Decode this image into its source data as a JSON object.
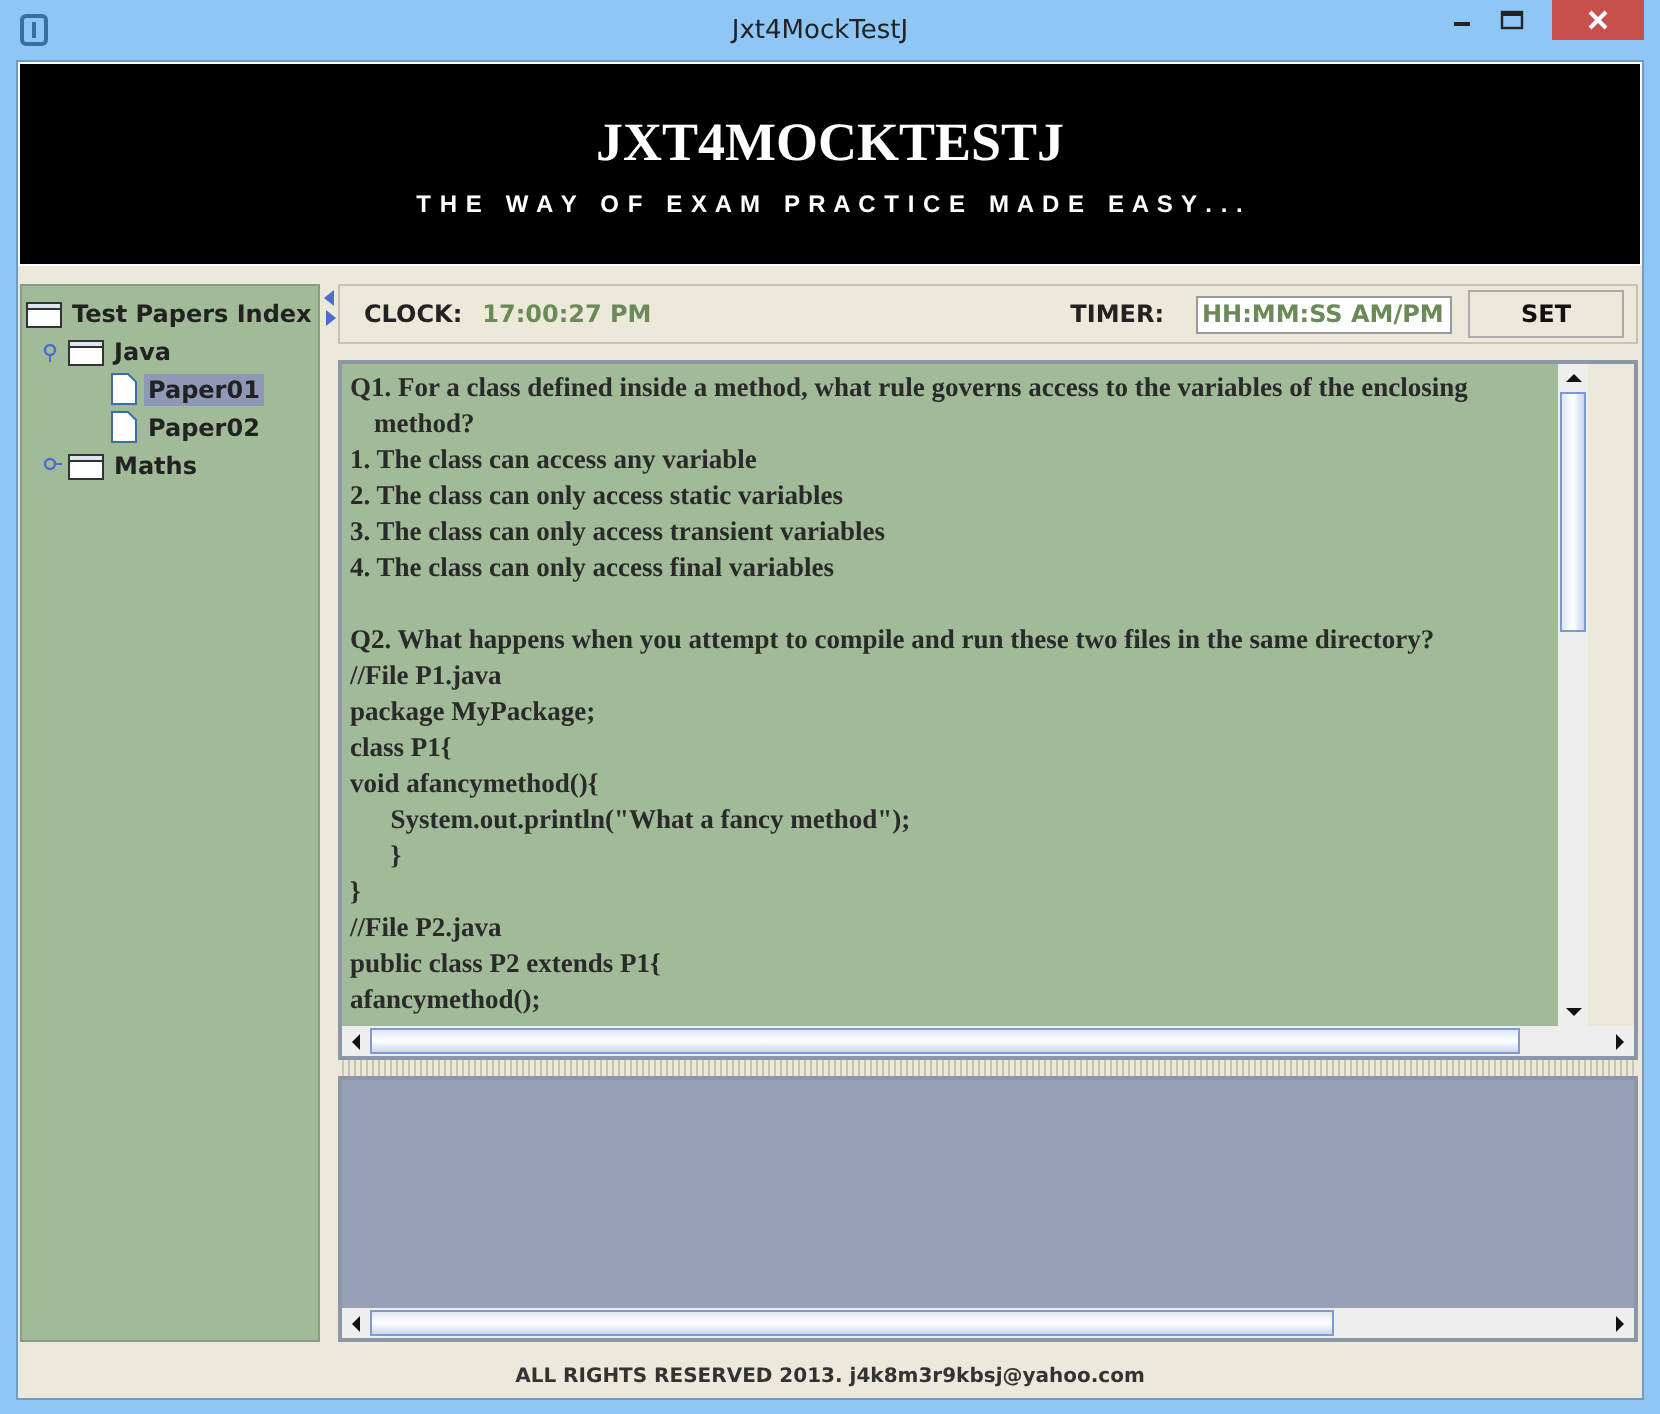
{
  "window": {
    "title": "Jxt4MockTestJ"
  },
  "banner": {
    "title": "JXT4MOCKTESTJ",
    "tagline": "T H E   W A Y   O F   E X A M   P R A C T I C E   M A D E   E A S Y . . ."
  },
  "tree": {
    "root": "Test Papers Index",
    "items": [
      {
        "label": "Java",
        "kind": "folder",
        "expanded": true,
        "selected": false,
        "children": [
          {
            "label": "Paper01",
            "kind": "file",
            "selected": true
          },
          {
            "label": "Paper02",
            "kind": "file",
            "selected": false
          }
        ]
      },
      {
        "label": "Maths",
        "kind": "folder",
        "expanded": false,
        "selected": false
      }
    ]
  },
  "clock": {
    "label": "CLOCK:",
    "value": "17:00:27 PM"
  },
  "timer": {
    "label": "TIMER:",
    "placeholder": "HH:MM:SS AM/PM",
    "button": "SET"
  },
  "questions": [
    {
      "lines": [
        "Q1. For a class defined inside a method, what rule governs access to the variables of the enclosing method?",
        "1. The class can access any variable",
        "2. The class can only access static variables",
        "3. The class can only access transient variables",
        "4. The class can only access final variables"
      ]
    },
    {
      "lines": [
        "Q2. What happens when you attempt to compile and run these two files in the same directory?",
        "//File P1.java",
        "package MyPackage;",
        "class P1{",
        "void afancymethod(){",
        "      System.out.println(\"What a fancy method\");",
        "      }",
        "}",
        "//File P2.java",
        "public class P2 extends P1{",
        "afancymethod();"
      ]
    }
  ],
  "footer": "ALL RIGHTS RESERVED 2013. j4k8m3r9kbsj@yahoo.com"
}
